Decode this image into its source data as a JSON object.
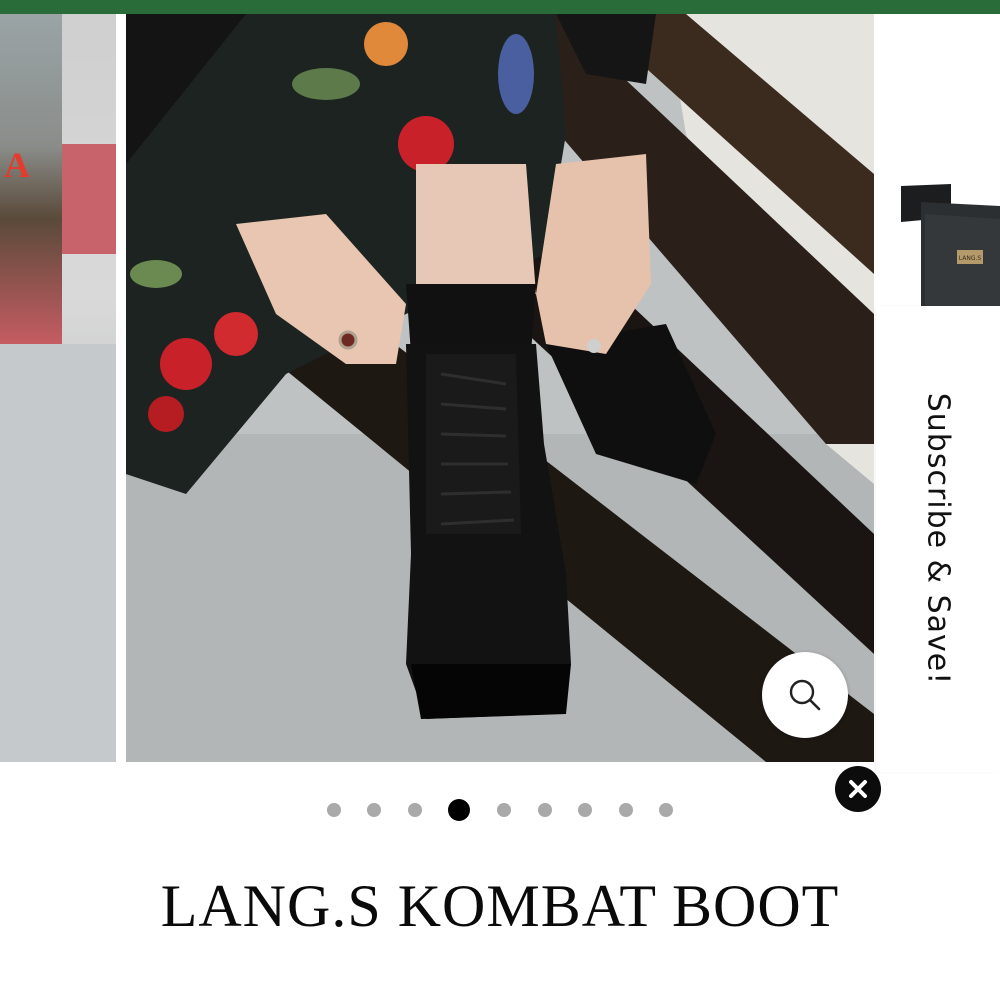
{
  "slider": {
    "slide_count": 9,
    "active_index": 3,
    "slides": [
      {
        "name": "slide-previous"
      },
      {
        "name": "slide-current"
      },
      {
        "name": "slide-next"
      }
    ]
  },
  "product": {
    "title": "LANG.S KOMBAT BOOT",
    "next_item_tag": "LANG.S"
  },
  "subscribe_tab": {
    "label": "Subscribe & Save!"
  },
  "icons": {
    "zoom": "search-icon",
    "close": "close-icon"
  },
  "colors": {
    "top_bar": "#2a6b3a",
    "dot_inactive": "#a9a9a9",
    "dot_active": "#000000",
    "text": "#0a0a0a"
  }
}
